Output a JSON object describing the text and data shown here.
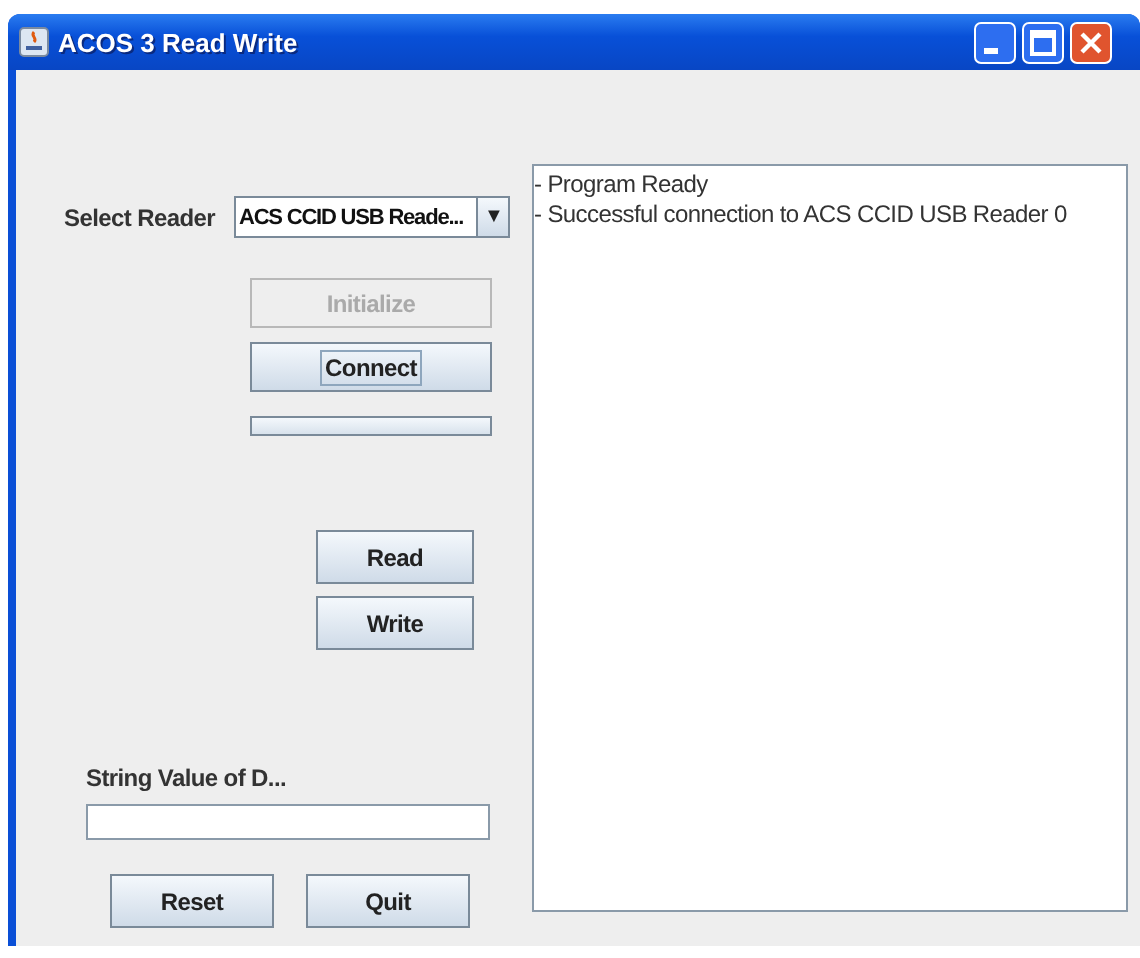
{
  "window": {
    "title": "ACOS 3 Read Write"
  },
  "reader": {
    "label": "Select Reader",
    "value": "ACS CCID USB Reade...",
    "arrow": "▼"
  },
  "buttons": [
    {
      "label": "Initialize",
      "disabled": true,
      "focused": false
    },
    {
      "label": "Connect",
      "disabled": false,
      "focused": true
    }
  ],
  "progress": {
    "level": 0
  },
  "actions": [
    {
      "label": "Read"
    },
    {
      "label": "Write"
    }
  ],
  "string_value": {
    "label": "String Value of D..."
  },
  "bottom_buttons": [
    {
      "label": "Reset"
    },
    {
      "label": "Quit"
    }
  ],
  "log": [
    "- Program Ready",
    "- Successful connection to ACS CCID USB Reader 0"
  ]
}
